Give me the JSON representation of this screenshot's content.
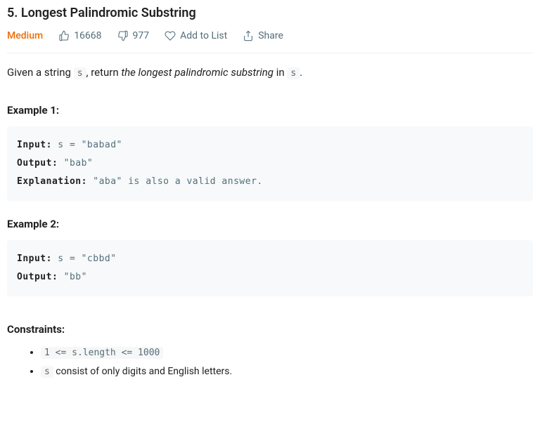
{
  "title": "5. Longest Palindromic Substring",
  "meta": {
    "difficulty": "Medium",
    "likes": "16668",
    "dislikes": "977",
    "add_to_list": "Add to List",
    "share": "Share"
  },
  "desc": {
    "prefix": "Given a string ",
    "code1": "s",
    "middle1": ", return ",
    "em": "the longest palindromic substring",
    "middle2": " in ",
    "code2": "s",
    "suffix": "."
  },
  "example1_head": "Example 1:",
  "example1": {
    "input_lbl": "Input:",
    "input_val": " s = \"babad\"",
    "output_lbl": "Output:",
    "output_val": " \"bab\"",
    "expl_lbl": "Explanation:",
    "expl_val": " \"aba\" is also a valid answer."
  },
  "example2_head": "Example 2:",
  "example2": {
    "input_lbl": "Input:",
    "input_val": " s = \"cbbd\"",
    "output_lbl": "Output:",
    "output_val": " \"bb\""
  },
  "constraints_head": "Constraints:",
  "constraints": {
    "c1": "1 <= s.length <= 1000",
    "c2_code": "s",
    "c2_text": " consist of only digits and English letters."
  }
}
